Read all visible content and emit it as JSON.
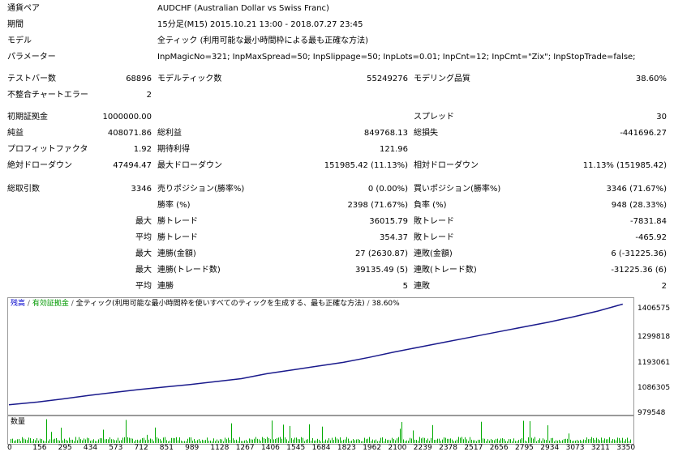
{
  "header": [
    {
      "label": "通貨ペア",
      "value": "AUDCHF (Australian Dollar vs Swiss Franc)"
    },
    {
      "label": "期間",
      "value": "15分足(M15) 2015.10.21 13:00 - 2018.07.27 23:45"
    },
    {
      "label": "モデル",
      "value": "全ティック (利用可能な最小時間枠による最も正確な方法)"
    },
    {
      "label": "パラメーター",
      "value": "InpMagicNo=321; InpMaxSpread=50; InpSlippage=50; InpLots=0.01; InpCnt=12; InpCmt=\"Zix\"; InpStopTrade=false;"
    }
  ],
  "stats": {
    "test_bars_label": "テストバー数",
    "test_bars": "68896",
    "model_ticks_label": "モデルティック数",
    "model_ticks": "55249276",
    "model_quality_label": "モデリング品質",
    "model_quality": "38.60%",
    "mismatch_label": "不整合チャートエラー",
    "mismatch": "2",
    "initial_deposit_label": "初期証拠金",
    "initial_deposit": "1000000.00",
    "spread_label": "スプレッド",
    "spread": "30",
    "net_profit_label": "純益",
    "net_profit": "408071.86",
    "gross_profit_label": "総利益",
    "gross_profit": "849768.13",
    "gross_loss_label": "総損失",
    "gross_loss": "-441696.27",
    "profit_factor_label": "プロフィットファクタ",
    "profit_factor": "1.92",
    "expected_payoff_label": "期待利得",
    "expected_payoff": "121.96",
    "abs_dd_label": "絶対ドローダウン",
    "abs_dd": "47494.47",
    "max_dd_label": "最大ドローダウン",
    "max_dd": "151985.42 (11.13%)",
    "rel_dd_label": "相対ドローダウン",
    "rel_dd": "11.13% (151985.42)",
    "total_trades_label": "総取引数",
    "total_trades": "3346",
    "short_label": "売りポジション(勝率%)",
    "short": "0 (0.00%)",
    "long_label": "買いポジション(勝率%)",
    "long": "3346 (71.67%)"
  },
  "detail_rows": [
    {
      "prefix": "",
      "a_label": "勝率 (%)",
      "a_value": "2398 (71.67%)",
      "b_label": "負率 (%)",
      "b_value": "948 (28.33%)"
    },
    {
      "prefix": "最大",
      "a_label": "勝トレード",
      "a_value": "36015.79",
      "b_label": "敗トレード",
      "b_value": "-7831.84"
    },
    {
      "prefix": "平均",
      "a_label": "勝トレード",
      "a_value": "354.37",
      "b_label": "敗トレード",
      "b_value": "-465.92"
    },
    {
      "prefix": "最大",
      "a_label": "連勝(金額)",
      "a_value": "27 (2630.87)",
      "b_label": "連敗(金額)",
      "b_value": "6 (-31225.36)"
    },
    {
      "prefix": "最大",
      "a_label": "連勝(トレード数)",
      "a_value": "39135.49 (5)",
      "b_label": "連敗(トレード数)",
      "b_value": "-31225.36 (6)"
    },
    {
      "prefix": "平均",
      "a_label": "連勝",
      "a_value": "5",
      "b_label": "連敗",
      "b_value": "2"
    }
  ],
  "graph": {
    "legend_balance": "残高",
    "legend_equity": "有効証拠金",
    "legend_model": "全ティック(利用可能な最小時間枠を使いすべてのティックを生成する、最も正確な方法)",
    "legend_quality": "38.60%",
    "volume_label": "数量",
    "colors": {
      "balance": "#1a1a8c",
      "equity": "#009900",
      "volume": "#00aa00",
      "legend_balance": "#0000cc"
    }
  },
  "chart_data": {
    "type": "line",
    "x_ticks": [
      "0",
      "156",
      "295",
      "434",
      "573",
      "712",
      "851",
      "989",
      "1128",
      "1267",
      "1406",
      "1545",
      "1684",
      "1823",
      "1962",
      "2100",
      "2239",
      "2378",
      "2517",
      "2656",
      "2795",
      "2934",
      "3073",
      "3211",
      "3350"
    ],
    "y_ticks": [
      "1406575",
      "1299818",
      "1193061",
      "1086305",
      "979548"
    ],
    "series": [
      {
        "name": "残高",
        "x": [
          0,
          156,
          295,
          434,
          573,
          712,
          851,
          989,
          1128,
          1267,
          1406,
          1545,
          1684,
          1823,
          1962,
          2100,
          2239,
          2378,
          2517,
          2656,
          2795,
          2934,
          3073,
          3211,
          3346
        ],
        "y": [
          1000000,
          1011000,
          1024000,
          1038000,
          1050000,
          1062000,
          1072000,
          1082000,
          1094000,
          1106000,
          1126000,
          1141000,
          1157000,
          1172000,
          1192000,
          1214000,
          1234000,
          1254000,
          1274000,
          1294000,
          1314000,
          1334000,
          1356000,
          1380000,
          1408071
        ]
      }
    ],
    "ylim": [
      979548,
      1413000
    ],
    "xlim": [
      0,
      3400
    ]
  }
}
